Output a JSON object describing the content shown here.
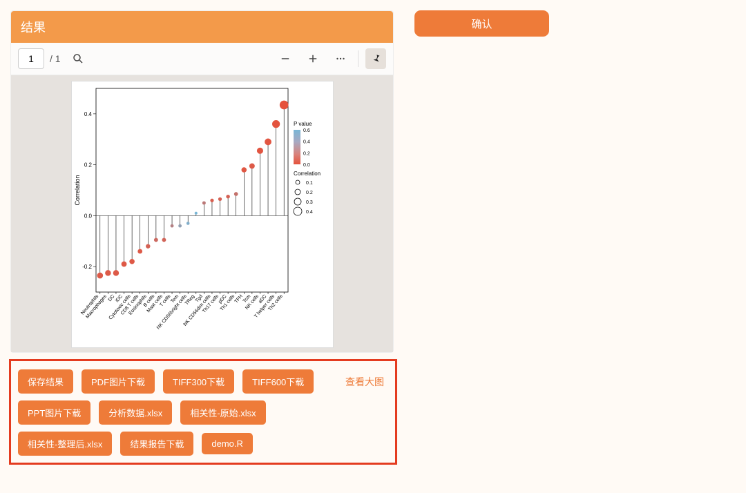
{
  "panel": {
    "title": "结果"
  },
  "toolbar": {
    "page_current": "1",
    "page_total": "/ 1"
  },
  "confirm": {
    "label": "确认"
  },
  "view_large": "查看大图",
  "buttons": {
    "row1": [
      "保存结果",
      "PDF图片下载",
      "TIFF300下载",
      "TIFF600下载"
    ],
    "row2": [
      "PPT图片下载",
      "分析数据.xlsx",
      "相关性-原始.xlsx"
    ],
    "row3": [
      "相关性-整理后.xlsx",
      "结果报告下载",
      "demo.R"
    ]
  },
  "colors": {
    "accent": "#ee7b39",
    "header": "#f39a4a",
    "highlight_border": "#e43b1f",
    "plot_bg": "#e6e2de"
  },
  "chart_data": {
    "type": "lollipop",
    "ylabel": "Correlation",
    "ylim": [
      -0.3,
      0.5
    ],
    "yticks": [
      -0.2,
      0.0,
      0.2,
      0.4
    ],
    "legend_pvalue_title": "P value",
    "legend_pvalue_ticks": [
      0.6,
      0.4,
      0.2,
      0.0
    ],
    "legend_size_title": "Correlation",
    "legend_size_ticks": [
      0.1,
      0.2,
      0.3,
      0.4
    ],
    "series": [
      {
        "category": "Neutrophils",
        "correlation": -0.235,
        "pvalue": 0.05
      },
      {
        "category": "Macrophages",
        "correlation": -0.225,
        "pvalue": 0.05
      },
      {
        "category": "DC",
        "correlation": -0.225,
        "pvalue": 0.05
      },
      {
        "category": "iDC",
        "correlation": -0.19,
        "pvalue": 0.04
      },
      {
        "category": "Cytotoxic cells",
        "correlation": -0.18,
        "pvalue": 0.04
      },
      {
        "category": "CD8 T cells",
        "correlation": -0.14,
        "pvalue": 0.05
      },
      {
        "category": "Eosinophils",
        "correlation": -0.12,
        "pvalue": 0.1
      },
      {
        "category": "B cells",
        "correlation": -0.095,
        "pvalue": 0.15
      },
      {
        "category": "Mast cells",
        "correlation": -0.095,
        "pvalue": 0.12
      },
      {
        "category": "T cells",
        "correlation": -0.04,
        "pvalue": 0.3
      },
      {
        "category": "Tem",
        "correlation": -0.04,
        "pvalue": 0.5
      },
      {
        "category": "NK CD56bright cells",
        "correlation": -0.03,
        "pvalue": 0.6
      },
      {
        "category": "TReg",
        "correlation": 0.01,
        "pvalue": 0.65
      },
      {
        "category": "Tgd",
        "correlation": 0.05,
        "pvalue": 0.25
      },
      {
        "category": "NK CD56dim cells",
        "correlation": 0.06,
        "pvalue": 0.08
      },
      {
        "category": "Th17 cells",
        "correlation": 0.065,
        "pvalue": 0.1
      },
      {
        "category": "pDC",
        "correlation": 0.075,
        "pvalue": 0.1
      },
      {
        "category": "Th1 cells",
        "correlation": 0.085,
        "pvalue": 0.2
      },
      {
        "category": "TFH",
        "correlation": 0.18,
        "pvalue": 0.03
      },
      {
        "category": "Tcm",
        "correlation": 0.195,
        "pvalue": 0.05
      },
      {
        "category": "NK cells",
        "correlation": 0.255,
        "pvalue": 0.02
      },
      {
        "category": "aDC",
        "correlation": 0.29,
        "pvalue": 0.02
      },
      {
        "category": "T helper cells",
        "correlation": 0.36,
        "pvalue": 0.01
      },
      {
        "category": "Th2 cells",
        "correlation": 0.435,
        "pvalue": 0.0
      }
    ]
  }
}
